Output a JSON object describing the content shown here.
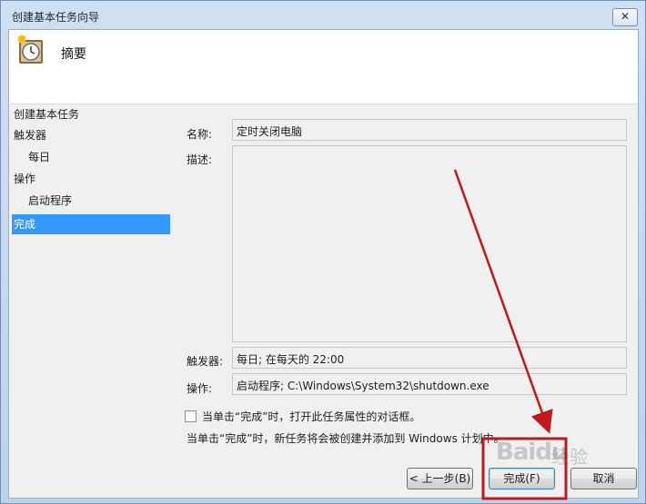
{
  "window": {
    "title": "创建基本任务向导",
    "close_glyph": "✕"
  },
  "header": {
    "title": "摘要",
    "icon": "clock-icon"
  },
  "nav": {
    "items": [
      {
        "label": "创建基本任务",
        "indent": false,
        "active": false
      },
      {
        "label": "触发器",
        "indent": false,
        "active": false
      },
      {
        "label": "每日",
        "indent": true,
        "active": false
      },
      {
        "label": "操作",
        "indent": false,
        "active": false
      },
      {
        "label": "启动程序",
        "indent": true,
        "active": false
      },
      {
        "label": "完成",
        "indent": false,
        "active": true
      }
    ]
  },
  "form": {
    "name_label": "名称:",
    "name_value": "定时关闭电脑",
    "desc_label": "描述:",
    "desc_value": "",
    "trigger_label": "触发器:",
    "trigger_value": "每日; 在每天的 22:00",
    "action_label": "操作:",
    "action_value": "启动程序; C:\\Windows\\System32\\shutdown.exe"
  },
  "checkbox": {
    "label": "当单击“完成”时，打开此任务属性的对话框。",
    "checked": false
  },
  "note": "当单击“完成”时，新任务将会被创建并添加到 Windows 计划中。",
  "buttons": {
    "back": "< 上一步(B)",
    "finish": "完成(F)",
    "cancel": "取消"
  },
  "watermark": {
    "text": "Baidu",
    "sub": "经验"
  },
  "annotation_color": "#c0181c"
}
